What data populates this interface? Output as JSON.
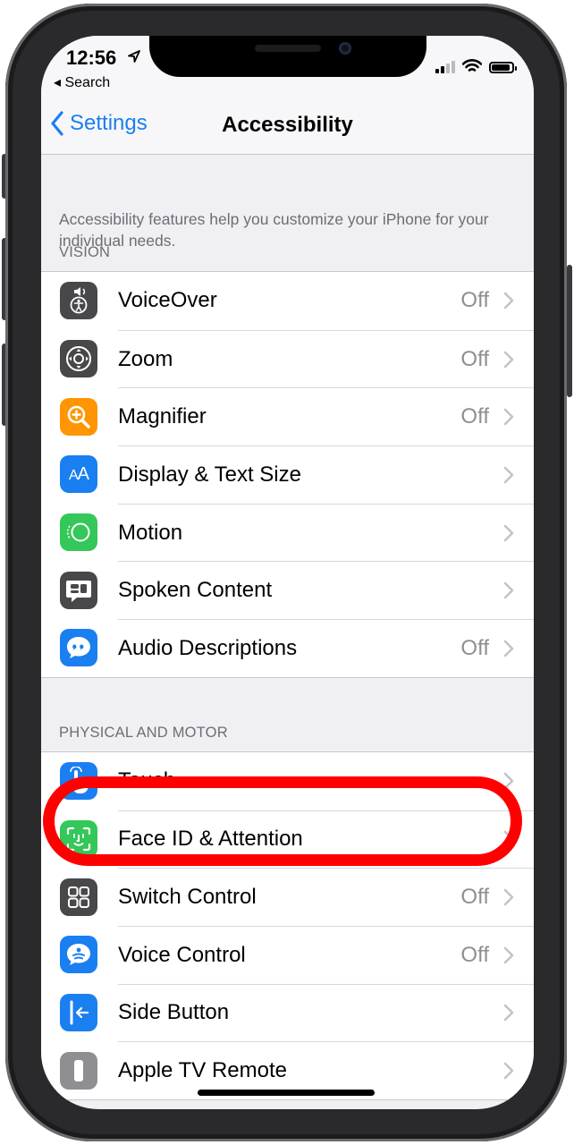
{
  "status_bar": {
    "time": "12:56",
    "back_app": "◂ Search"
  },
  "nav": {
    "back_label": "Settings",
    "title": "Accessibility"
  },
  "intro": "Accessibility features help you customize your iPhone for your individual needs.",
  "sections": [
    {
      "header": "VISION",
      "items": [
        {
          "label": "VoiceOver",
          "value": "Off",
          "icon": "voiceover-icon",
          "color": "#48484a"
        },
        {
          "label": "Zoom",
          "value": "Off",
          "icon": "zoom-icon",
          "color": "#48484a"
        },
        {
          "label": "Magnifier",
          "value": "Off",
          "icon": "magnifier-icon",
          "color": "#ff9500"
        },
        {
          "label": "Display & Text Size",
          "value": "",
          "icon": "text-size-icon",
          "color": "#1a7ff0"
        },
        {
          "label": "Motion",
          "value": "",
          "icon": "motion-icon",
          "color": "#34c759"
        },
        {
          "label": "Spoken Content",
          "value": "",
          "icon": "spoken-content-icon",
          "color": "#48484a"
        },
        {
          "label": "Audio Descriptions",
          "value": "Off",
          "icon": "speech-bubble-icon",
          "color": "#1a7ff0"
        }
      ]
    },
    {
      "header": "PHYSICAL AND MOTOR",
      "items": [
        {
          "label": "Touch",
          "value": "",
          "icon": "hand-pointer-icon",
          "color": "#1a7ff0"
        },
        {
          "label": "Face ID & Attention",
          "value": "",
          "icon": "face-id-icon",
          "color": "#34c759"
        },
        {
          "label": "Switch Control",
          "value": "Off",
          "icon": "switch-control-icon",
          "color": "#48484a"
        },
        {
          "label": "Voice Control",
          "value": "Off",
          "icon": "voice-control-icon",
          "color": "#1a7ff0"
        },
        {
          "label": "Side Button",
          "value": "",
          "icon": "side-button-icon",
          "color": "#1a7ff0"
        },
        {
          "label": "Apple TV Remote",
          "value": "",
          "icon": "remote-icon",
          "color": "#8e8e93"
        }
      ]
    }
  ],
  "colors": {
    "accent": "#1a7ff0",
    "highlight": "#ff0000"
  }
}
